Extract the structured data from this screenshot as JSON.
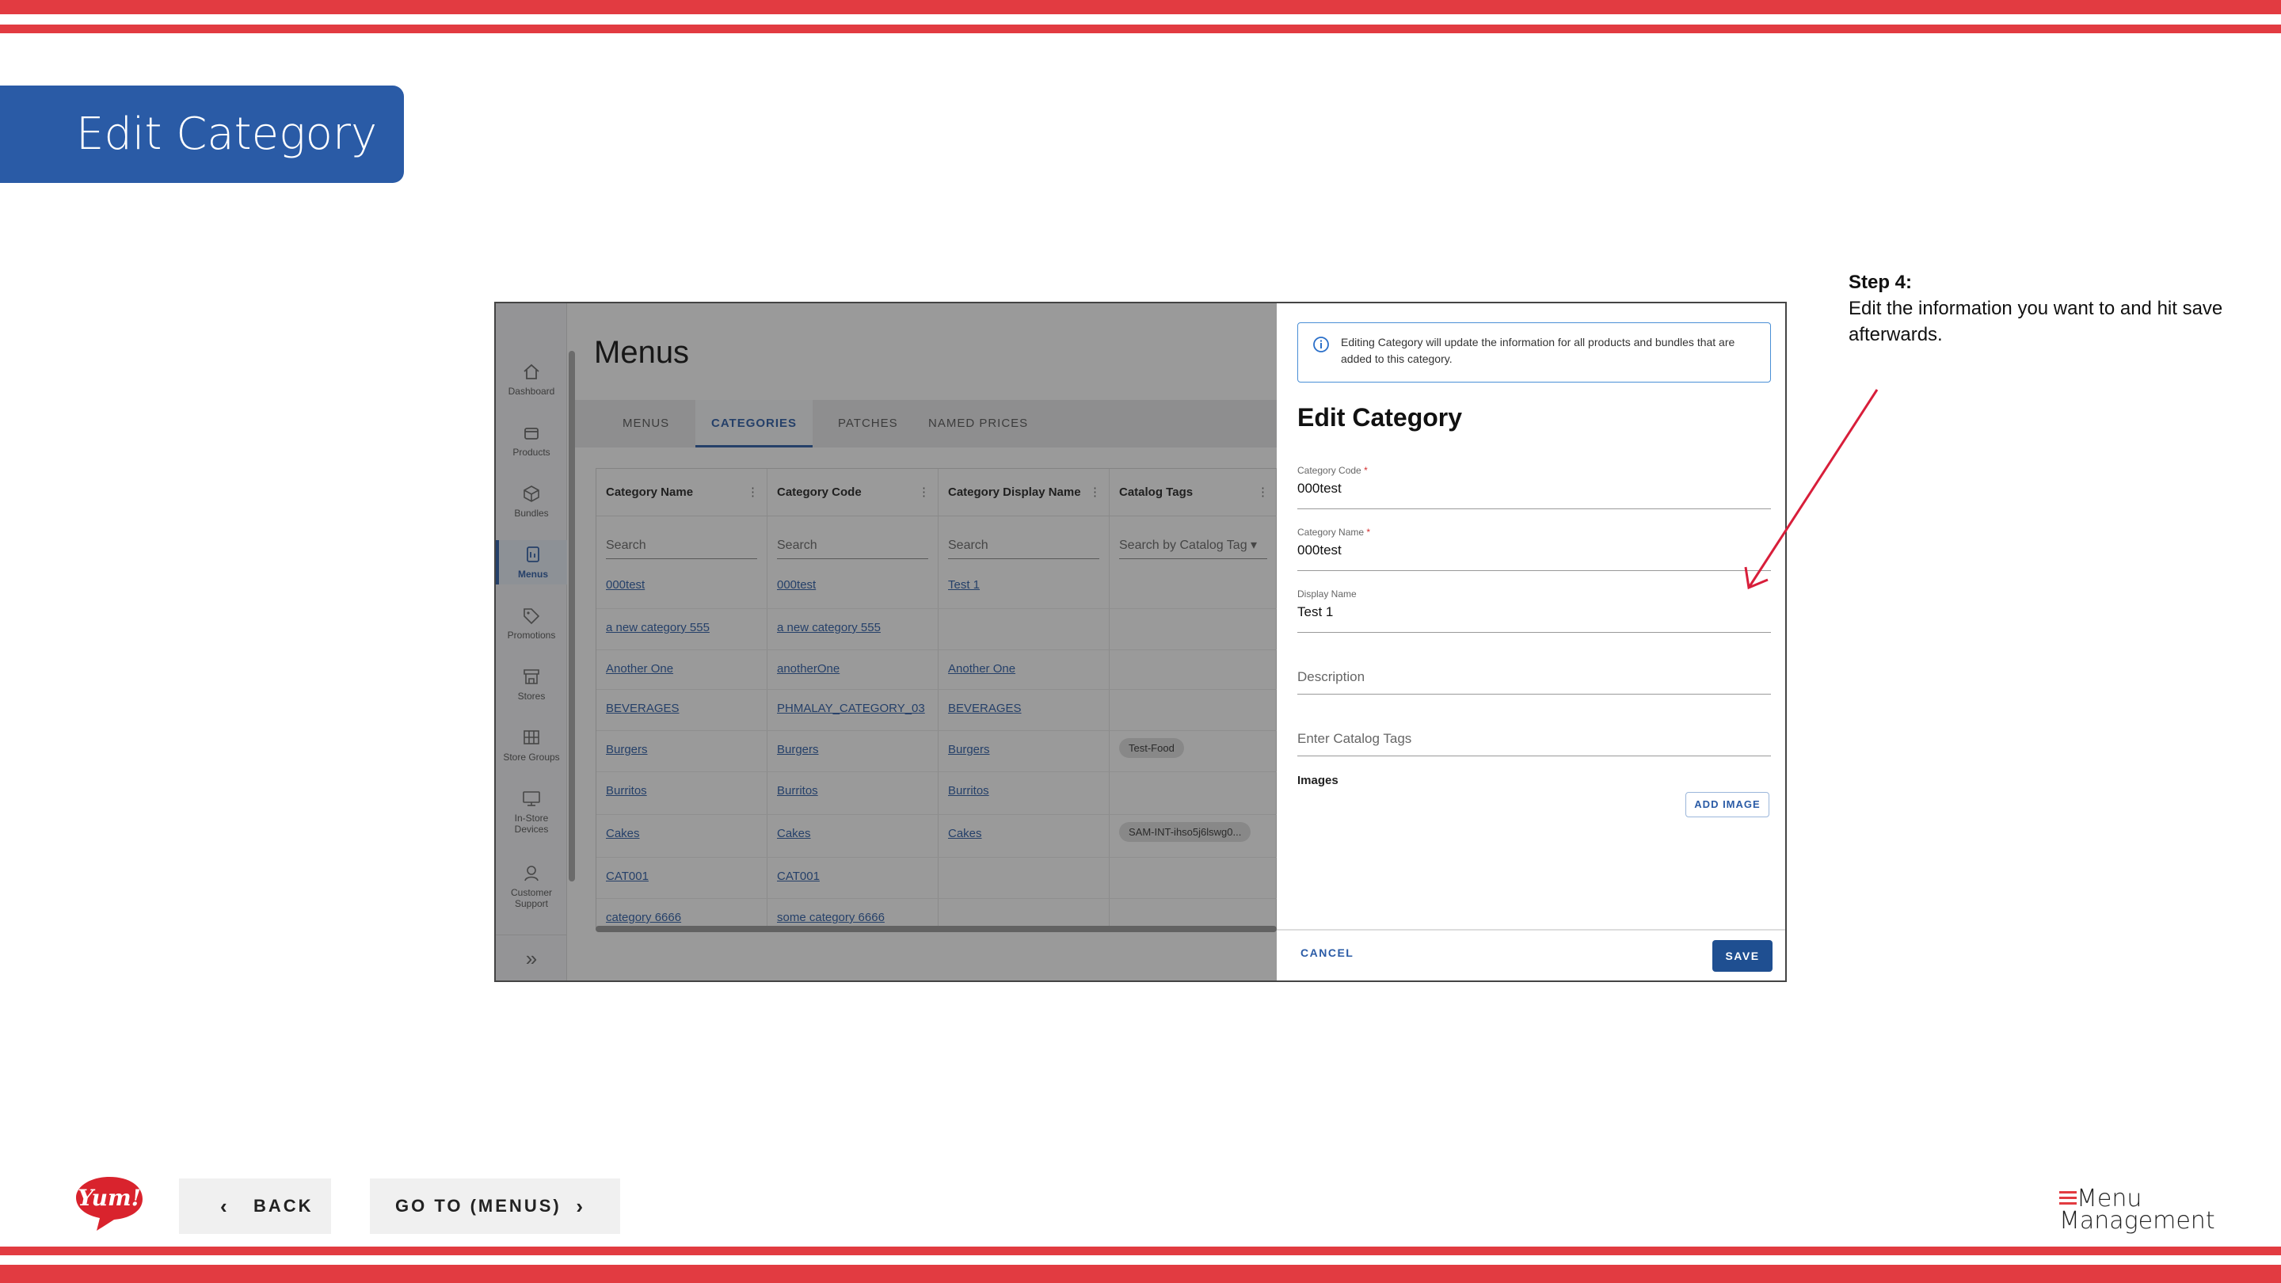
{
  "slide": {
    "title": "Edit Category",
    "step_heading": "Step 4:",
    "step_text": "Edit the information you want to and hit save afterwards."
  },
  "app": {
    "sidebar": [
      {
        "label": "Dashboard",
        "icon": "home-icon"
      },
      {
        "label": "Products",
        "icon": "box-icon"
      },
      {
        "label": "Bundles",
        "icon": "cube-icon"
      },
      {
        "label": "Menus",
        "icon": "menu-doc-icon",
        "active": true
      },
      {
        "label": "Promotions",
        "icon": "tag-icon"
      },
      {
        "label": "Stores",
        "icon": "store-icon"
      },
      {
        "label": "Store Groups",
        "icon": "grid-icon"
      },
      {
        "label": "In-Store Devices",
        "icon": "monitor-icon"
      },
      {
        "label": "Customer Support",
        "icon": "support-icon"
      }
    ],
    "page_title": "Menus",
    "tabs": [
      "MENUS",
      "CATEGORIES",
      "PATCHES",
      "NAMED PRICES"
    ],
    "active_tab": "CATEGORIES",
    "columns": [
      "Category Name",
      "Category Code",
      "Category Display Name",
      "Catalog Tags"
    ],
    "search_placeholders": [
      "Search",
      "Search",
      "Search",
      "Search by Catalog Tag"
    ],
    "rows": [
      {
        "name": "000test",
        "code": "000test",
        "display": "Test 1",
        "tag": ""
      },
      {
        "name": "a new category 555",
        "code": "a new category 555",
        "display": "",
        "tag": ""
      },
      {
        "name": "Another One",
        "code": "anotherOne",
        "display": "Another One",
        "tag": ""
      },
      {
        "name": "BEVERAGES",
        "code": "PHMALAY_CATEGORY_03",
        "display": "BEVERAGES",
        "tag": ""
      },
      {
        "name": "Burgers",
        "code": "Burgers",
        "display": "Burgers",
        "tag": "Test-Food"
      },
      {
        "name": "Burritos",
        "code": "Burritos",
        "display": "Burritos",
        "tag": ""
      },
      {
        "name": "Cakes",
        "code": "Cakes",
        "display": "Cakes",
        "tag": "SAM-INT-ihso5j6lswg0..."
      },
      {
        "name": "CAT001",
        "code": "CAT001",
        "display": "",
        "tag": ""
      },
      {
        "name": "category 6666",
        "code": "some category 6666",
        "display": "",
        "tag": ""
      }
    ]
  },
  "panel": {
    "info_text": "Editing Category will update the information for all products and bundles that are added to this category.",
    "heading": "Edit Category",
    "fields": {
      "code_label": "Category Code",
      "code_value": "000test",
      "name_label": "Category Name",
      "name_value": "000test",
      "display_label": "Display Name",
      "display_value": "Test 1",
      "description_placeholder": "Description",
      "tags_placeholder": "Enter Catalog Tags"
    },
    "images_label": "Images",
    "add_image": "ADD IMAGE",
    "cancel": "CANCEL",
    "save": "SAVE"
  },
  "nav": {
    "back": "BACK",
    "goto": "GO TO (MENUS)"
  },
  "logos": {
    "yum": "Yum!",
    "mm_line1": "Menu",
    "mm_line2": "Management"
  },
  "colors": {
    "brand_red": "#e23b41",
    "brand_blue": "#2a5ba6",
    "save_blue": "#1f4f91"
  }
}
